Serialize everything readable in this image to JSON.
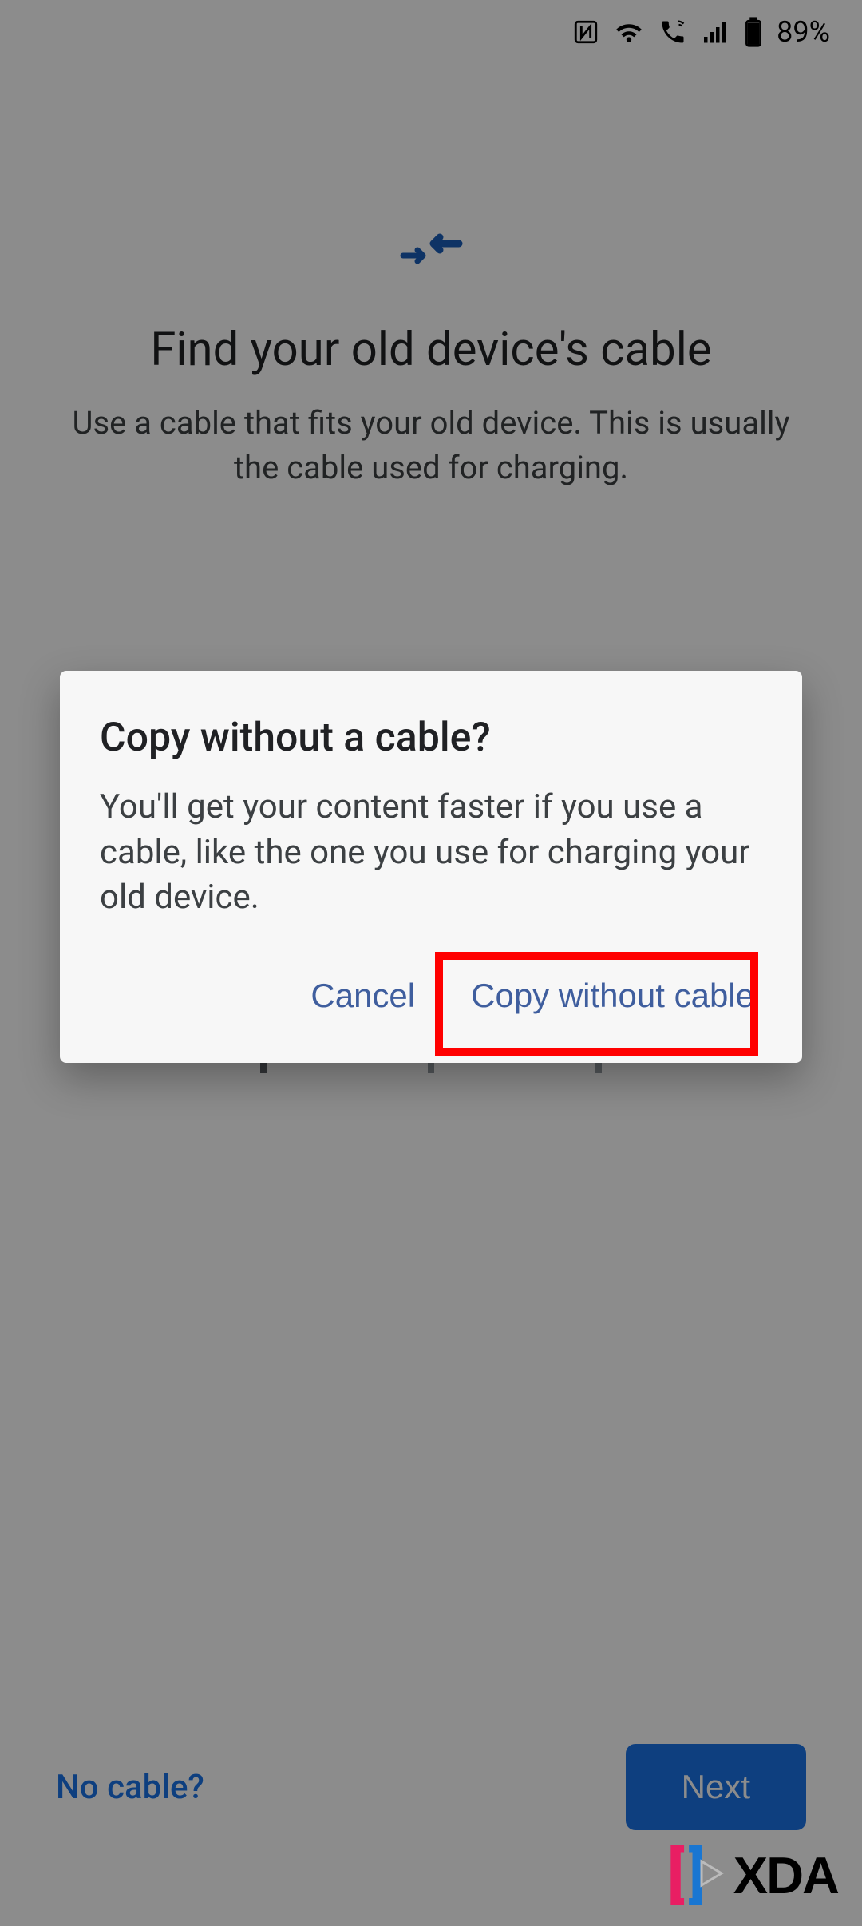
{
  "status_bar": {
    "battery_percent": "89%"
  },
  "background": {
    "title": "Find your old device's cable",
    "subtitle": "Use a cable that fits your old device. This is usually the cable used for charging.",
    "no_cable_link": "No cable?",
    "next_button": "Next"
  },
  "dialog": {
    "title": "Copy without a cable?",
    "body": "You'll get your content faster if you use a cable, like the one you use for charging your old device.",
    "cancel_label": "Cancel",
    "confirm_label": "Copy without cable"
  },
  "watermark": {
    "text": "XDA"
  },
  "colors": {
    "primary_blue": "#1a73e8",
    "dialog_button": "#3f5e9e",
    "highlight": "#ff0000"
  }
}
